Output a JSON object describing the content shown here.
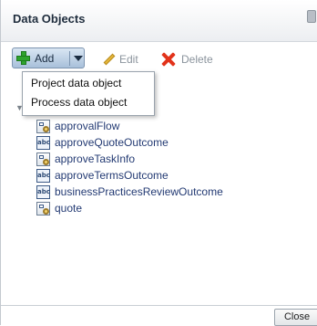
{
  "header": {
    "title": "Data Objects",
    "right_icon": "panel-icon"
  },
  "toolbar": {
    "add_label": "Add",
    "edit_label": "Edit",
    "delete_label": "Delete"
  },
  "add_menu": {
    "items": [
      {
        "label": "Project data object"
      },
      {
        "label": "Process data object"
      }
    ]
  },
  "data_objects": [
    {
      "name": "approvalFlow",
      "icon": "complex-type-icon"
    },
    {
      "name": "approveQuoteOutcome",
      "icon": "string-type-icon"
    },
    {
      "name": "approveTaskInfo",
      "icon": "complex-type-icon"
    },
    {
      "name": "approveTermsOutcome",
      "icon": "string-type-icon"
    },
    {
      "name": "businessPracticesReviewOutcome",
      "icon": "string-type-icon"
    },
    {
      "name": "quote",
      "icon": "complex-type-icon"
    }
  ],
  "string_icon_text": "abc",
  "footer": {
    "close_label": "Close"
  },
  "colors": {
    "add_green": "#2ea32e",
    "delete_red": "#e2331b",
    "link_blue": "#233a73"
  }
}
